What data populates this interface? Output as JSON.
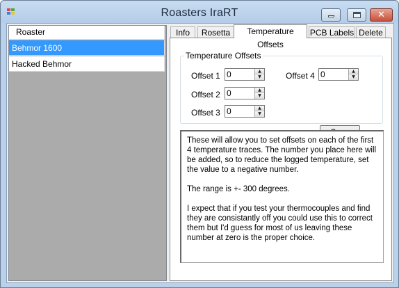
{
  "window": {
    "title": "Roasters IraRT",
    "controls": {
      "minimize": "minimize",
      "maximize": "maximize",
      "close": "✕"
    }
  },
  "roaster_list": {
    "header": "Roaster",
    "items": [
      {
        "label": "Behmor 1600",
        "selected": true
      },
      {
        "label": "Hacked Behmor",
        "selected": false
      }
    ]
  },
  "tabs": [
    {
      "label": "Info",
      "active": false
    },
    {
      "label": "Rosetta",
      "active": false
    },
    {
      "label": "Temperature Offsets",
      "active": true
    },
    {
      "label": "PCB Labels",
      "active": false
    },
    {
      "label": "Delete",
      "active": false
    }
  ],
  "offsets": {
    "group_title": "Temperature Offsets",
    "fields": [
      {
        "label": "Offset 1",
        "value": "0"
      },
      {
        "label": "Offset 2",
        "value": "0"
      },
      {
        "label": "Offset 3",
        "value": "0"
      },
      {
        "label": "Offset 4",
        "value": "0"
      }
    ],
    "save_label": "Save"
  },
  "help": {
    "paragraphs": [
      "These will allow you to set offsets on each of the first 4 temperature traces. The number you place here will be added, so to reduce the logged temperature, set the value to a negative number.",
      "The range is +- 300 degrees.",
      "I expect that if you test your thermocouples and find they are consistantly off you could use this to correct them but I'd guess for most of us leaving these number at zero is the proper choice."
    ]
  },
  "colors": {
    "selection": "#3399ff",
    "list_background": "#ababab",
    "close_button": "#c7503a"
  }
}
